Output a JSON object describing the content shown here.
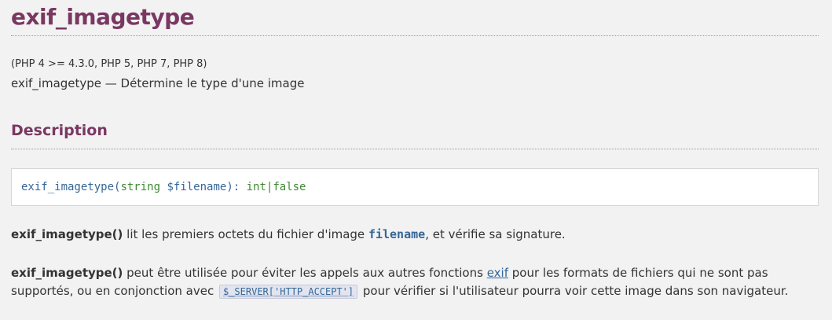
{
  "page": {
    "title": "exif_imagetype",
    "version_info": "(PHP 4 >= 4.3.0, PHP 5, PHP 7, PHP 8)",
    "purpose": "exif_imagetype — Détermine le type d'une image"
  },
  "description": {
    "heading": "Description",
    "synopsis": {
      "function_name": "exif_imagetype",
      "open_paren": "(",
      "param_type": "string",
      "param_name": "$filename",
      "close_paren": "): ",
      "return_type": "int|false"
    }
  },
  "paragraph1": {
    "function": "exif_imagetype()",
    "text_before": " lit les premiers octets du fichier d'image ",
    "param": "filename",
    "text_after": ", et vérifie sa signature."
  },
  "paragraph2": {
    "function": "exif_imagetype()",
    "text_before": " peut être utilisée pour éviter les appels aux autres fonctions ",
    "link": "exif",
    "text_middle": " pour les formats de fichiers qui ne sont pas supportés, ou en conjonction avec ",
    "code": "$_SERVER['HTTP_ACCEPT']",
    "text_after": " pour vérifier si l'utilisateur pourra voir cette image dans son navigateur."
  }
}
